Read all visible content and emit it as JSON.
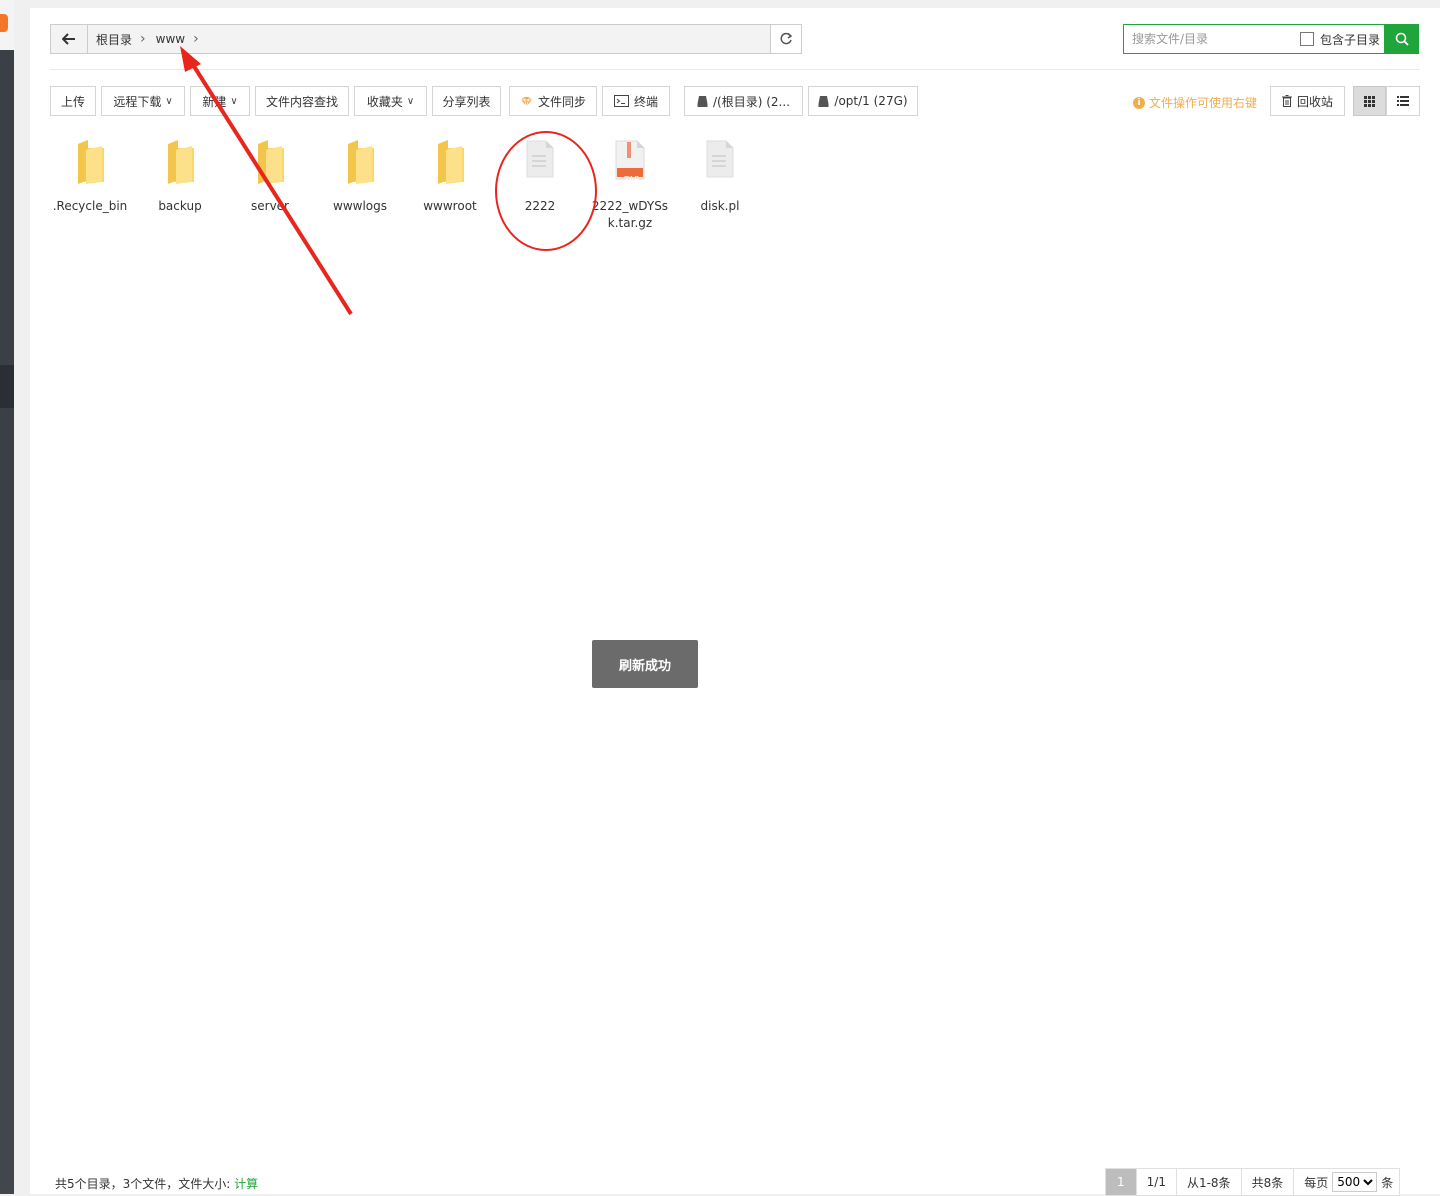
{
  "breadcrumb": {
    "root": "根目录",
    "current": "www"
  },
  "search": {
    "placeholder": "搜索文件/目录",
    "include_sub_label": "包含子目录"
  },
  "toolbar": {
    "upload": "上传",
    "remote_download": "远程下载",
    "new": "新建",
    "content_search": "文件内容查找",
    "favorites": "收藏夹",
    "share_list": "分享列表",
    "file_sync": "文件同步",
    "terminal": "终端",
    "disk_root": "/(根目录) (2...",
    "disk_opt": "/opt/1 (27G)",
    "tip": "文件操作可使用右键",
    "recycle_bin": "回收站"
  },
  "files": [
    {
      "name": ".Recycle_bin",
      "type": "folder"
    },
    {
      "name": "backup",
      "type": "folder"
    },
    {
      "name": "server",
      "type": "folder"
    },
    {
      "name": "wwwlogs",
      "type": "folder"
    },
    {
      "name": "wwwroot",
      "type": "folder"
    },
    {
      "name": "2222",
      "type": "file"
    },
    {
      "name": "2222_wDYSsk.tar.gz",
      "type": "tar",
      "badge": "TAR"
    },
    {
      "name": "disk.pl",
      "type": "file"
    }
  ],
  "toast": "刷新成功",
  "footer": {
    "summary": "共5个目录，3个文件，文件大小:",
    "calc_link": "计算",
    "current_page": "1",
    "page_of": "1/1",
    "range": "从1-8条",
    "total": "共8条",
    "per_page_label": "每页",
    "per_page_value": "500",
    "per_page_unit": "条"
  },
  "colors": {
    "accent": "#20a53a",
    "warning": "#f0ad4e",
    "annotation": "#e8261e"
  }
}
